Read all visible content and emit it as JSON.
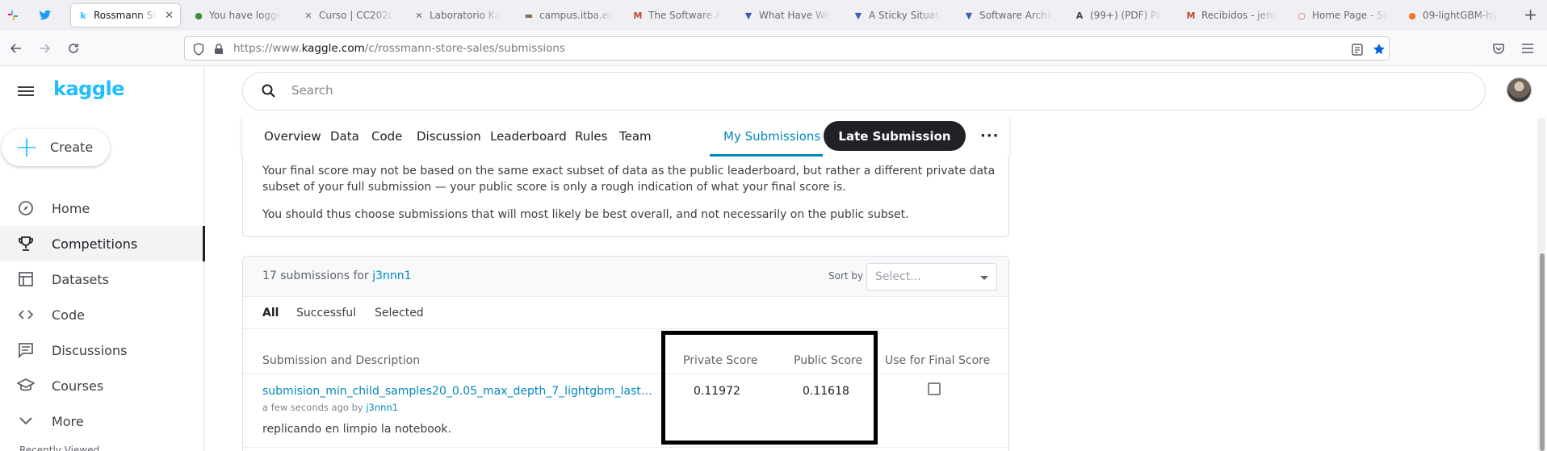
{
  "browser": {
    "tabs": [
      {
        "label": "Rossmann St",
        "favicon": "k",
        "color": "#20beff",
        "active": true
      },
      {
        "label": "You have logge",
        "favicon": "●",
        "color": "#3c8c3c",
        "active": false
      },
      {
        "label": "Curso | CC2020",
        "favicon": "✕",
        "color": "#5b6b8c",
        "active": false
      },
      {
        "label": "Laboratorio Ka",
        "favicon": "✕",
        "color": "#5b6b8c",
        "active": false
      },
      {
        "label": "campus.itba.ed",
        "favicon": "▬",
        "color": "#8a6a50",
        "active": false
      },
      {
        "label": "The Software A",
        "favicon": "M",
        "color": "#c4452f",
        "active": false
      },
      {
        "label": "What Have We",
        "favicon": "▼",
        "color": "#3a63b8",
        "active": false
      },
      {
        "label": "A Sticky Situati",
        "favicon": "▼",
        "color": "#3a63b8",
        "active": false
      },
      {
        "label": "Software Archit",
        "favicon": "▼",
        "color": "#3a63b8",
        "active": false
      },
      {
        "label": "(99+) (PDF) Pa",
        "favicon": "A",
        "color": "#444",
        "active": false
      },
      {
        "label": "Recibidos - jenn",
        "favicon": "M",
        "color": "#c4452f",
        "active": false
      },
      {
        "label": "Home Page - Se",
        "favicon": "○",
        "color": "#e8584a",
        "active": false
      },
      {
        "label": "09-lightGBM-hy",
        "favicon": "●",
        "color": "#f37626",
        "active": false
      }
    ],
    "url_prefix": "https://www.",
    "url_domain": "kaggle.com",
    "url_path": "/c/rossmann-store-sales/submissions"
  },
  "sidebar": {
    "logo": "kaggle",
    "create_label": "Create",
    "items": [
      {
        "label": "Home",
        "icon": "compass-icon"
      },
      {
        "label": "Competitions",
        "icon": "trophy-icon",
        "active": true
      },
      {
        "label": "Datasets",
        "icon": "table-icon"
      },
      {
        "label": "Code",
        "icon": "code-icon"
      },
      {
        "label": "Discussions",
        "icon": "comment-icon"
      },
      {
        "label": "Courses",
        "icon": "school-icon"
      },
      {
        "label": "More",
        "icon": "chevron-down-icon"
      }
    ],
    "recently_viewed": "Recently Viewed"
  },
  "search": {
    "placeholder": "Search"
  },
  "subnav": {
    "tabs": [
      "Overview",
      "Data",
      "Code",
      "Discussion",
      "Leaderboard",
      "Rules",
      "Team"
    ],
    "active_tab": "My Submissions",
    "late_submission": "Late Submission",
    "more": "···"
  },
  "info": {
    "p1": "Your final score may not be based on the same exact subset of data as the public leaderboard, but rather a different private data subset of your full submission — your public score is only a rough indication of what your final score is.",
    "p2": "You should thus choose submissions that will most likely be best overall, and not necessarily on the public subset."
  },
  "submissions": {
    "count_text": "17 submissions for",
    "user": "j3nnn1",
    "sort_by_label": "Sort by",
    "sort_placeholder": "Select...",
    "filters": [
      "All",
      "Successful",
      "Selected"
    ],
    "columns": {
      "description": "Submission and Description",
      "private": "Private Score",
      "public": "Public Score",
      "final": "Use for Final Score"
    },
    "rows": [
      {
        "filename": "submision_min_child_samples20_0.05_max_depth_7_lightgbm_last_wee...",
        "time": "a few seconds ago by",
        "by": "j3nnn1",
        "description": "replicando en limpio la notebook.",
        "private_score": "0.11972",
        "public_score": "0.11618",
        "use_for_final": false
      }
    ]
  },
  "colors": {
    "accent": "#20beff",
    "link": "#008abc",
    "dark": "#202124"
  }
}
